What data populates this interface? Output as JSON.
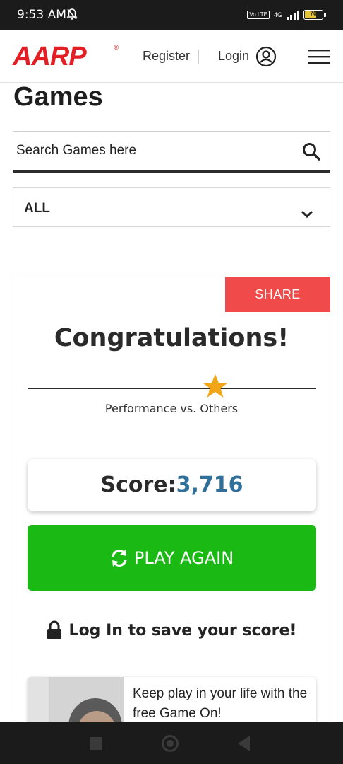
{
  "status_bar": {
    "time": "9:53 AM",
    "network": "4G",
    "volte": "Vo LTE",
    "battery_level": 70,
    "battery_text": "70"
  },
  "header": {
    "logo_text": "AARP",
    "register_label": "Register",
    "login_label": "Login"
  },
  "page": {
    "title": "Games"
  },
  "search": {
    "placeholder": "Search Games here"
  },
  "filter": {
    "selected": "ALL"
  },
  "result_card": {
    "share_label": "SHARE",
    "heading": "Congratulations!",
    "performance_label": "Performance vs. Others",
    "performance_position": 0.65,
    "score_label": "Score:",
    "score_value": "3,716",
    "play_again_label": "PLAY AGAIN",
    "login_save_label": "Log In to save your score!",
    "promo_text": "Keep play in your life with the free Game On!"
  },
  "colors": {
    "brand_red": "#e31f26",
    "share_red": "#f04a4a",
    "play_green": "#1ab914",
    "score_blue": "#2f6f99",
    "star_gold": "#f2a516"
  },
  "icons": [
    "bell-off-icon",
    "user-circle-icon",
    "hamburger-menu-icon",
    "search-icon",
    "chevron-down-icon",
    "star-icon",
    "refresh-icon",
    "lock-icon"
  ]
}
